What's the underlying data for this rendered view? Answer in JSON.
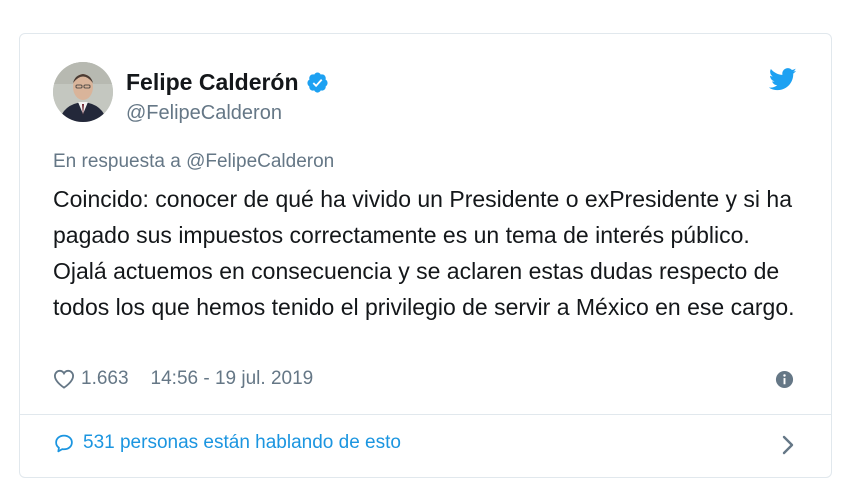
{
  "tweet": {
    "author": {
      "display_name": "Felipe Calderón",
      "handle": "@FelipeCalderon",
      "verified": true
    },
    "reply_prefix": "En respuesta a",
    "reply_to": "@FelipeCalderon",
    "text": "Coincido: conocer de qué ha vivido un Presidente o exPresidente y si ha pagado sus impuestos correctamente es un tema de interés público. Ojalá actuemos en consecuencia y se aclaren estas dudas respecto de todos los que hemos tenido el privilegio de servir a México en ese cargo.",
    "likes": "1.663",
    "timestamp": "14:56 - 19 jul. 2019",
    "conversation": "531 personas están hablando de esto"
  },
  "colors": {
    "brand": "#1da1f2",
    "link": "#1b95e0",
    "muted": "#657786",
    "text": "#14171a",
    "border": "#e1e8ed"
  },
  "icons": [
    "verified-badge-icon",
    "twitter-bird-icon",
    "heart-icon",
    "info-icon",
    "speech-bubble-icon",
    "chevron-right-icon"
  ]
}
